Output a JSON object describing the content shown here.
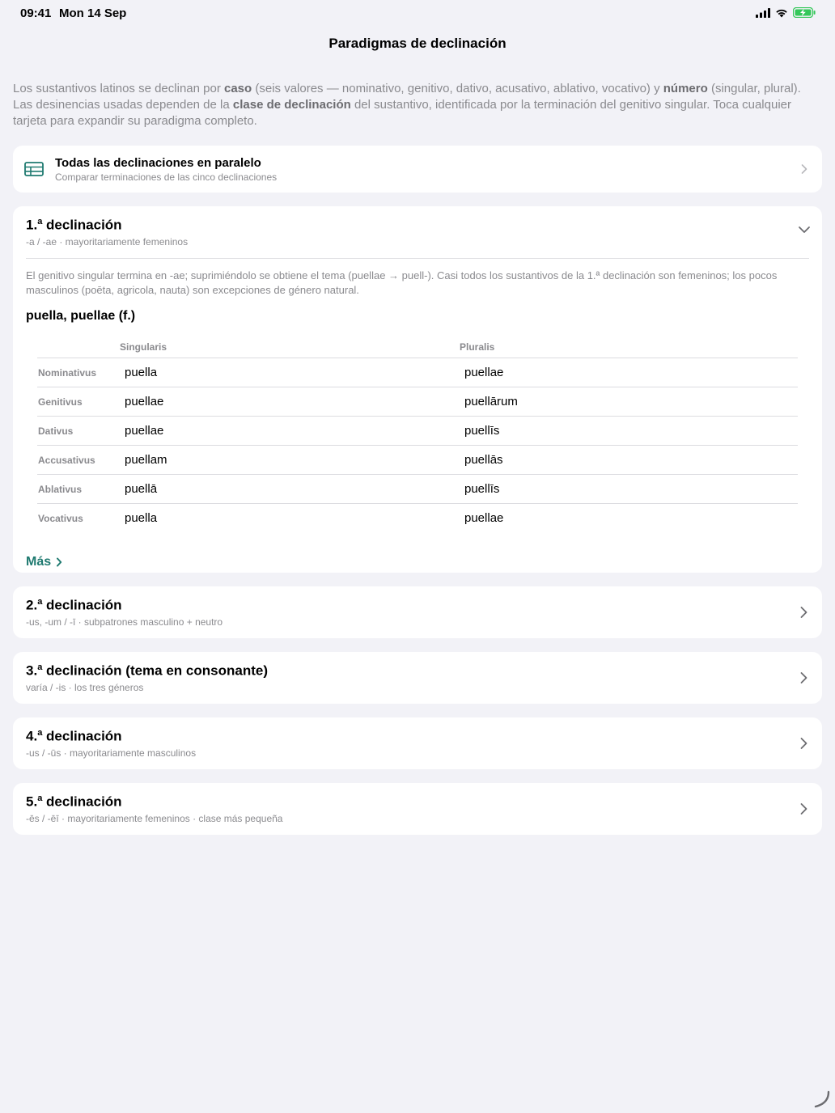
{
  "status": {
    "time": "09:41",
    "date": "Mon 14 Sep"
  },
  "nav": {
    "title": "Paradigmas de declinación"
  },
  "intro": {
    "t1": "Los sustantivos latinos se declinan por ",
    "b1": "caso",
    "t2": " (seis valores — nominativo, genitivo, dativo, acusativo, ablativo, vocativo) y ",
    "b2": "número",
    "t3": " (singular, plural). Las desinencias usadas dependen de la ",
    "b3": "clase de declinación",
    "t4": " del sustantivo, identificada por la terminación del genitivo singular. Toca cualquier tarjeta para expandir su paradigma completo."
  },
  "parallel": {
    "title": "Todas las declinaciones en paralelo",
    "subtitle": "Comparar terminaciones de las cinco declinaciones"
  },
  "first": {
    "num": "1.",
    "ord": "a",
    "word": " declinación",
    "subtitle": "-a / -ae · mayoritariamente femeninos",
    "description": "El genitivo singular termina en -ae; suprimiéndolo se obtiene el tema (puellae → puell-). Casi todos los sustantivos de la 1.ª declinación son femeninos; los pocos masculinos (poēta, agricola, nauta) son excepciones de género natural.",
    "lemma": "puella, puellae (f.)",
    "col_singular": "Singularis",
    "col_plural": "Pluralis",
    "rows": [
      {
        "case": "Nominativus",
        "sg": "puella",
        "pl": "puellae"
      },
      {
        "case": "Genitivus",
        "sg": "puellae",
        "pl": "puellārum"
      },
      {
        "case": "Dativus",
        "sg": "puellae",
        "pl": "puellīs"
      },
      {
        "case": "Accusativus",
        "sg": "puellam",
        "pl": "puellās"
      },
      {
        "case": "Ablativus",
        "sg": "puellā",
        "pl": "puellīs"
      },
      {
        "case": "Vocativus",
        "sg": "puella",
        "pl": "puellae"
      }
    ],
    "more_label": "Más"
  },
  "declensions": [
    {
      "num": "2.",
      "ord": "a",
      "word": " declinación",
      "subtitle": "-us, -um / -ī · subpatrones masculino + neutro"
    },
    {
      "num": "3.",
      "ord": "a",
      "word": " declinación (tema en consonante)",
      "subtitle": "varía / -is · los tres géneros"
    },
    {
      "num": "4.",
      "ord": "a",
      "word": " declinación",
      "subtitle": "-us / -ūs · mayoritariamente masculinos"
    },
    {
      "num": "5.",
      "ord": "a",
      "word": " declinación",
      "subtitle": "-ēs / -ēī · mayoritariamente femeninos · clase más pequeña"
    }
  ],
  "colors": {
    "accent": "#1f7a70",
    "background": "#f2f2f7",
    "battery": "#34c759"
  }
}
